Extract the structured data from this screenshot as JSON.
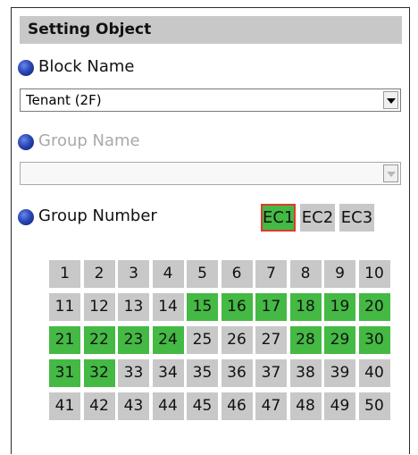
{
  "header": {
    "title": "Setting Object"
  },
  "block": {
    "label": "Block Name",
    "value": "Tenant (2F)"
  },
  "group": {
    "label": "Group Name",
    "value": ""
  },
  "group_number": {
    "label": "Group Number",
    "ec_buttons": [
      "EC1",
      "EC2",
      "EC3"
    ],
    "selected_ec": "EC1"
  },
  "grid": {
    "numbers": [
      1,
      2,
      3,
      4,
      5,
      6,
      7,
      8,
      9,
      10,
      11,
      12,
      13,
      14,
      15,
      16,
      17,
      18,
      19,
      20,
      21,
      22,
      23,
      24,
      25,
      26,
      27,
      28,
      29,
      30,
      31,
      32,
      33,
      34,
      35,
      36,
      37,
      38,
      39,
      40,
      41,
      42,
      43,
      44,
      45,
      46,
      47,
      48,
      49,
      50
    ],
    "active": [
      15,
      16,
      17,
      18,
      19,
      20,
      21,
      22,
      23,
      24,
      28,
      29,
      30,
      31,
      32
    ]
  },
  "colors": {
    "active": "#44b944",
    "inactive": "#c8c8c8",
    "selected_border": "#e03a2a"
  }
}
